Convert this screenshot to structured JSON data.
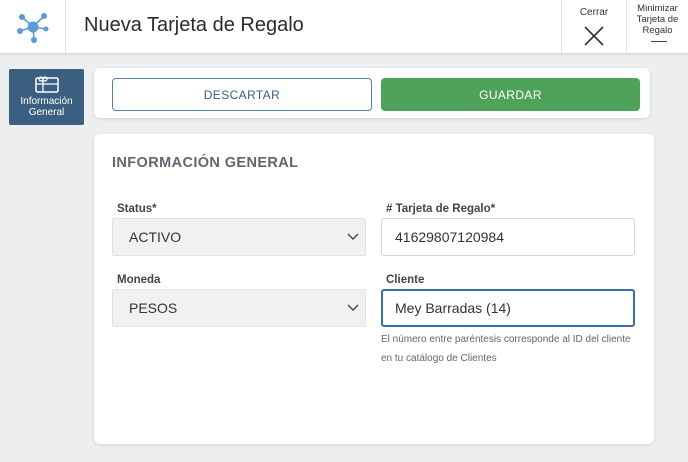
{
  "header": {
    "title": "Nueva Tarjeta de Regalo",
    "close_label": "Cerrar",
    "minimize_label": "Minimizar Tarjeta de Regalo"
  },
  "sidebar": {
    "items": [
      {
        "label": "Información General",
        "icon": "gift-card-icon",
        "active": true
      }
    ]
  },
  "actions": {
    "discard_label": "DESCARTAR",
    "save_label": "GUARDAR"
  },
  "form": {
    "section_title": "INFORMACIÓN GENERAL",
    "status": {
      "label": "Status*",
      "value": "ACTIVO"
    },
    "gift_card_number": {
      "label": "# Tarjeta de Regalo*",
      "value": "41629807120984"
    },
    "currency": {
      "label": "Moneda",
      "value": "PESOS"
    },
    "client": {
      "label": "Cliente",
      "value": "Mey Barradas (14)",
      "hint": "El número entre paréntesis corresponde al ID del cliente en tu catálogo de Clientes"
    }
  },
  "colors": {
    "accent_blue": "#3a5f80",
    "save_green": "#4fa25a",
    "focus_blue": "#3a6ea5",
    "logo_blue": "#5a9bd3"
  }
}
